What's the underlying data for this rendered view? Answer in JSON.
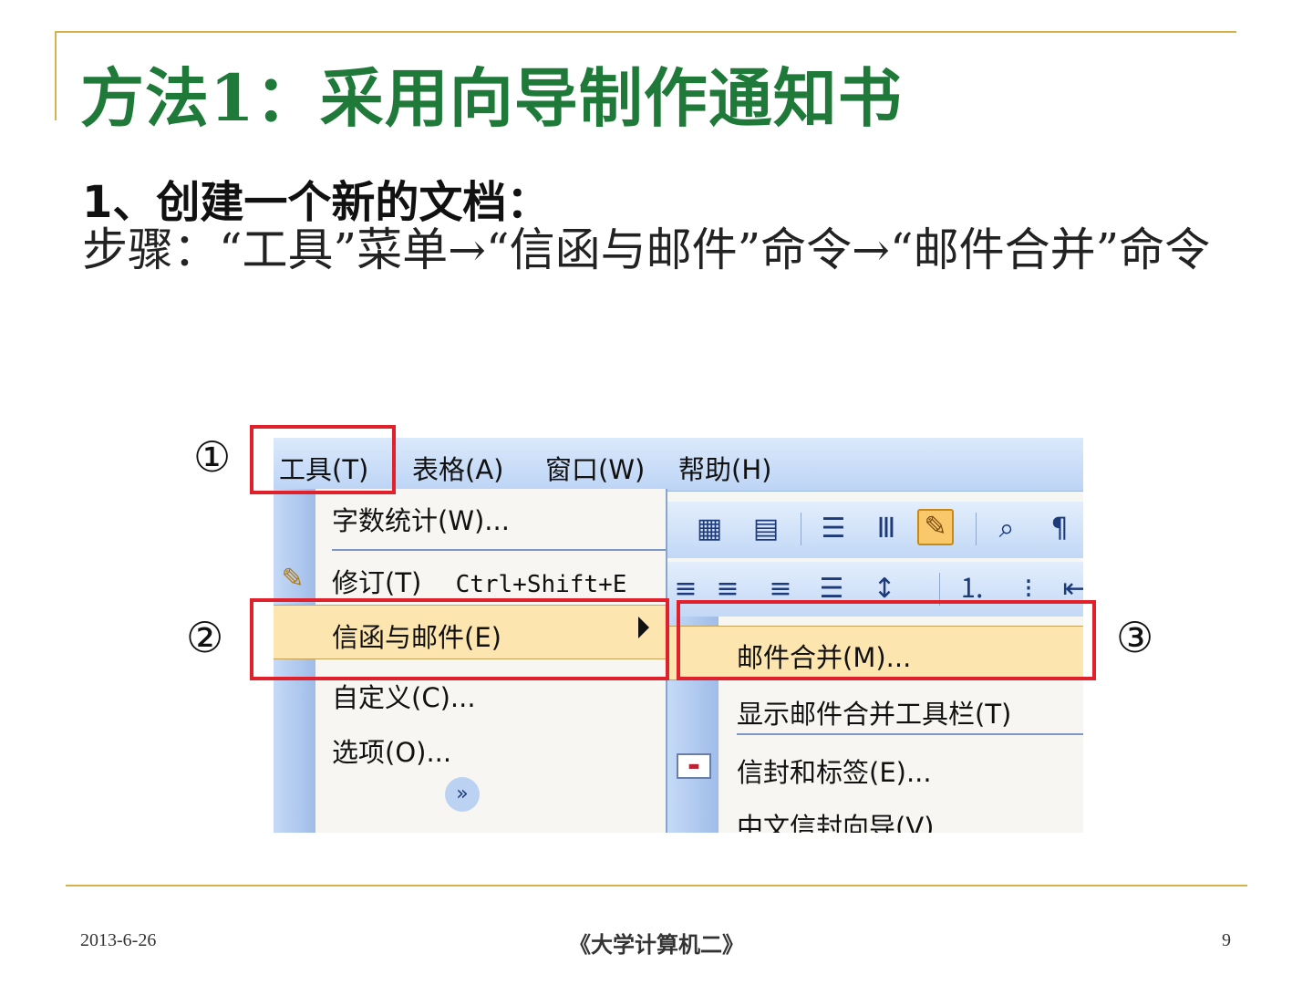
{
  "slide": {
    "title": "方法1：采用向导制作通知书",
    "subheading": "1、创建一个新的文档：",
    "steps": "步骤：“工具”菜单→“信函与邮件”命令→“邮件合并”命令"
  },
  "screenshot": {
    "menubar": [
      "工具(T)",
      "表格(A)",
      "窗口(W)",
      "帮助(H)"
    ],
    "tools_menu": {
      "word_count": "字数统计(W)...",
      "track_changes": "修订(T)",
      "track_changes_shortcut": "Ctrl+Shift+E",
      "letters_mailings": "信函与邮件(E)",
      "customize": "自定义(C)...",
      "options": "选项(O)..."
    },
    "submenu": {
      "mail_merge": "邮件合并(M)...",
      "show_toolbar": "显示邮件合并工具栏(T)",
      "envelopes_labels": "信封和标签(E)...",
      "chinese_envelope": "中文信封向导(V)"
    }
  },
  "callouts": [
    "①",
    "②",
    "③"
  ],
  "footer": {
    "date": "2013-6-26",
    "course": "《大学计算机二》",
    "page": "9"
  },
  "colors": {
    "title_green": "#1f7a3a",
    "rule_gold": "#d6b24a",
    "callout_red": "#e0202a",
    "menu_highlight": "#fde5b0"
  }
}
